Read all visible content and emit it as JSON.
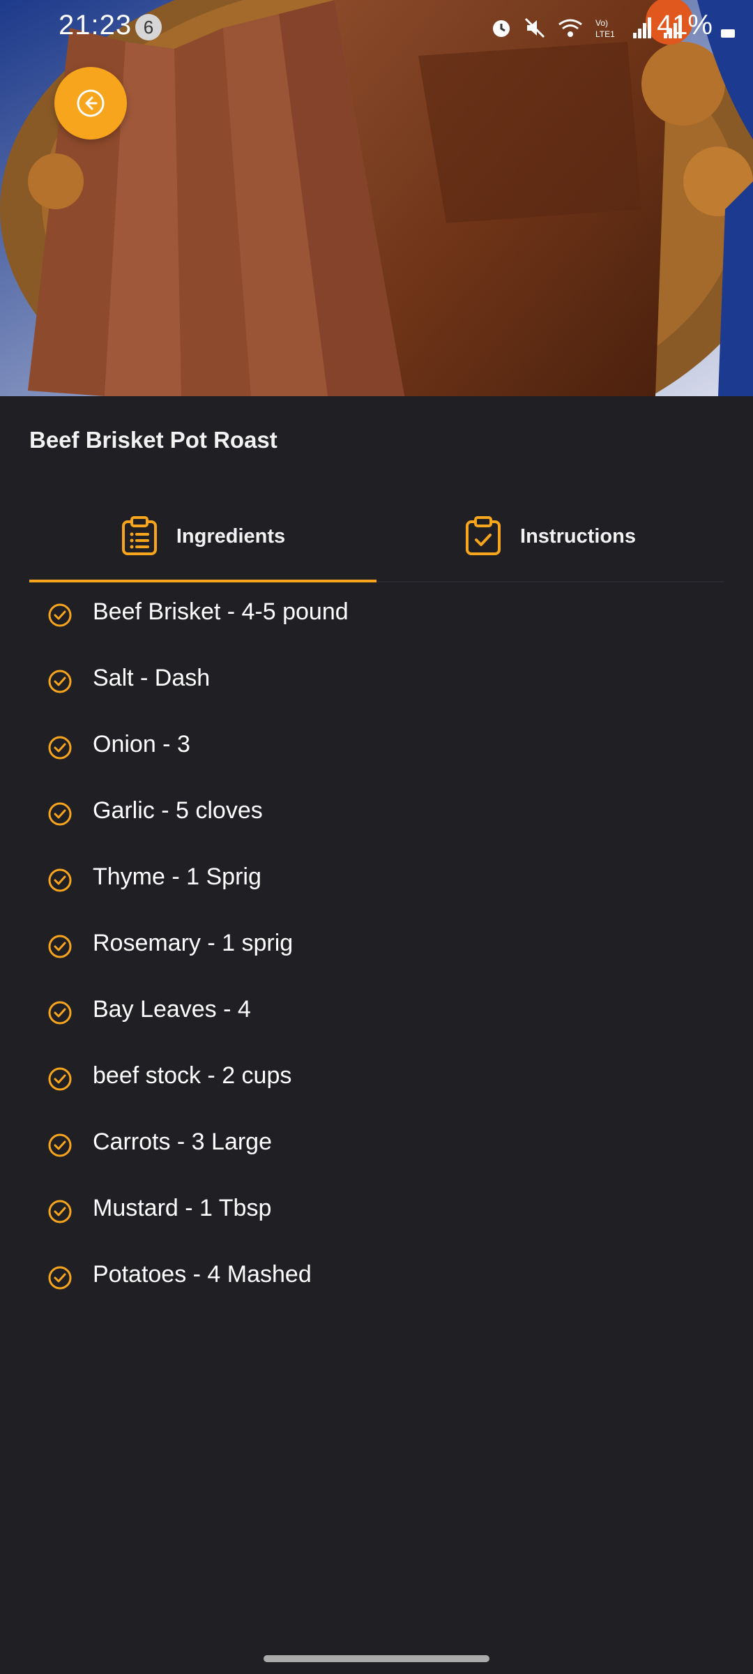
{
  "status_bar": {
    "time": "21:23",
    "notification_count": "6",
    "battery": "41%",
    "network_label": "Vo) LTE1"
  },
  "recipe": {
    "title": "Beef Brisket Pot Roast"
  },
  "tabs": [
    {
      "label": "Ingredients",
      "icon": "clipboard-list-icon",
      "selected": true
    },
    {
      "label": "Instructions",
      "icon": "clipboard-check-icon",
      "selected": false
    }
  ],
  "ingredients": [
    "Beef Brisket - 4-5 pound",
    "Salt - Dash",
    "Onion - 3",
    "Garlic - 5 cloves",
    "Thyme - 1 Sprig",
    "Rosemary - 1 sprig",
    "Bay Leaves - 4",
    "beef stock - 2 cups",
    "Carrots - 3 Large",
    "Mustard - 1 Tbsp",
    "Potatoes - 4 Mashed"
  ],
  "colors": {
    "accent": "#f8a51e",
    "background": "#1f1f24",
    "text": "#ffffff"
  }
}
